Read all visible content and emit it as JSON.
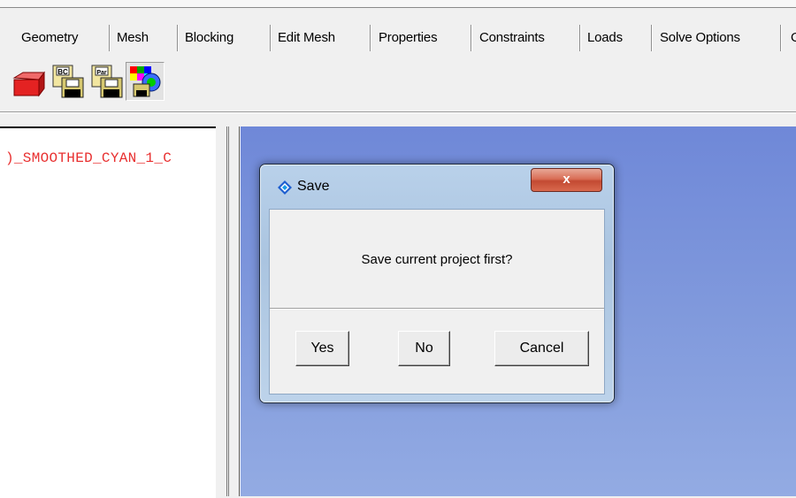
{
  "tabs": [
    "Geometry",
    "Mesh",
    "Blocking",
    "Edit Mesh",
    "Properties",
    "Constraints",
    "Loads",
    "Solve Options",
    "O"
  ],
  "toolbar": {
    "icons": [
      "red-box-icon",
      "save-bc-icon",
      "save-par-icon",
      "save-color-icon"
    ],
    "bc_label": "BC",
    "par_label": "Par"
  },
  "left_panel": {
    "text": ")_SMOOTHED_CYAN_1_C"
  },
  "dialog": {
    "title": "Save",
    "close_label": "x",
    "message": "Save current project first?",
    "buttons": {
      "yes": "Yes",
      "no": "No",
      "cancel": "Cancel"
    }
  },
  "colors": {
    "viewport_top": "#6f88d8",
    "viewport_bottom": "#93abe3",
    "left_text": "#e83030",
    "close_button": "#c34a32"
  }
}
